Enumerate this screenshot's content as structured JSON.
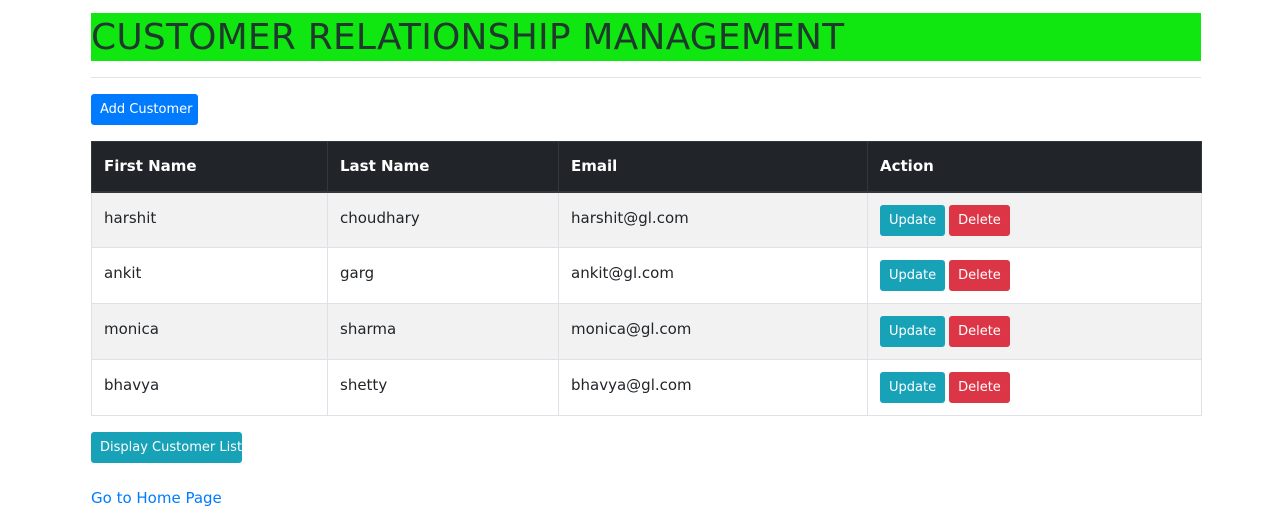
{
  "header": {
    "title": "CUSTOMER RELATIONSHIP MANAGEMENT",
    "title_bg_color": "#10e610"
  },
  "toolbar": {
    "add_label": "Add Customer"
  },
  "table": {
    "headers": [
      "First Name",
      "Last Name",
      "Email",
      "Action"
    ],
    "rows": [
      {
        "first_name": "harshit",
        "last_name": "choudhary",
        "email": "harshit@gl.com"
      },
      {
        "first_name": "ankit",
        "last_name": "garg",
        "email": "ankit@gl.com"
      },
      {
        "first_name": "monica",
        "last_name": "sharma",
        "email": "monica@gl.com"
      },
      {
        "first_name": "bhavya",
        "last_name": "shetty",
        "email": "bhavya@gl.com"
      }
    ],
    "update_label": "Update",
    "delete_label": "Delete"
  },
  "footer": {
    "display_label": "Display Customer List",
    "home_link": "Go to Home Page"
  },
  "colors": {
    "primary": "#007bff",
    "info": "#17a2b8",
    "danger": "#dc3545",
    "table_header": "#212529"
  }
}
